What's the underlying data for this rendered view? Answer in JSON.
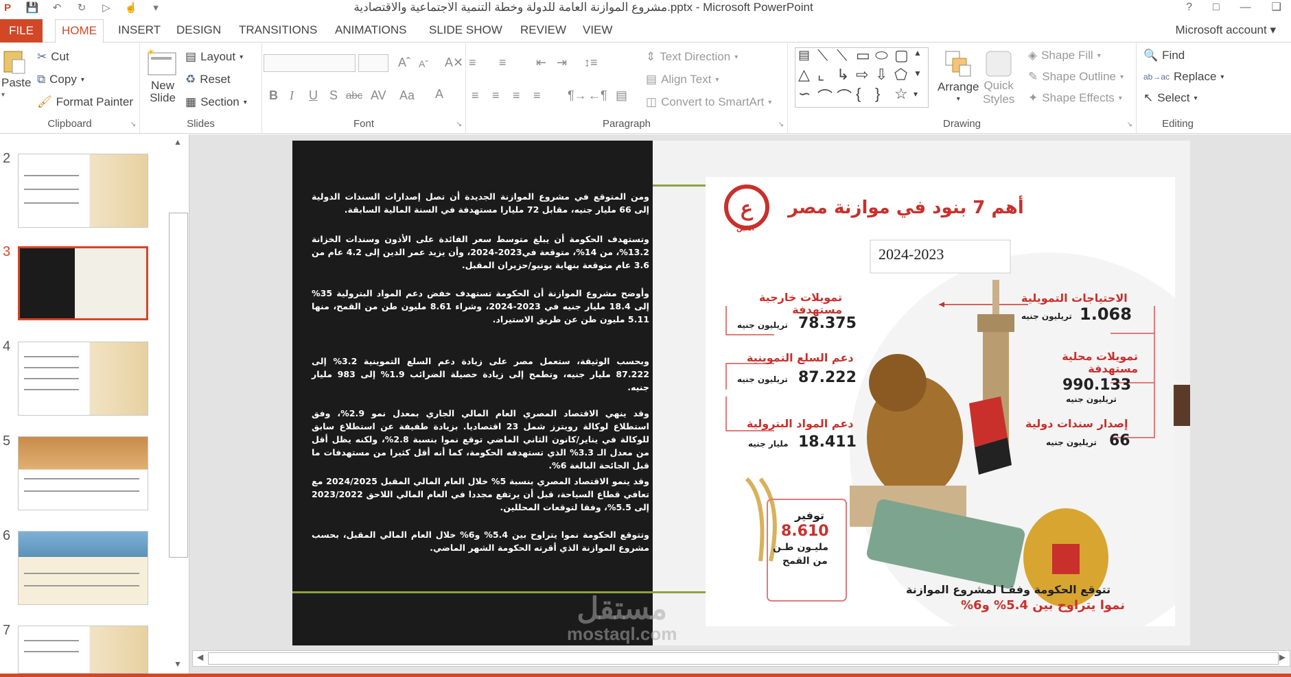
{
  "window": {
    "title": "مشروع الموازنة العامة للدولة وخطة التنمية الاجتماعية والاقتصادية.pptx - Microsoft PowerPoint",
    "help": "?",
    "account": "Microsoft account"
  },
  "tabs": [
    "FILE",
    "HOME",
    "INSERT",
    "DESIGN",
    "TRANSITIONS",
    "ANIMATIONS",
    "SLIDE SHOW",
    "REVIEW",
    "VIEW"
  ],
  "ribbon": {
    "clipboard": {
      "paste": "Paste",
      "cut": "Cut",
      "copy": "Copy",
      "format_painter": "Format Painter",
      "label": "Clipboard"
    },
    "slides": {
      "new_slide_1": "New",
      "new_slide_2": "Slide",
      "layout": "Layout",
      "reset": "Reset",
      "section": "Section",
      "label": "Slides"
    },
    "font": {
      "label": "Font"
    },
    "paragraph": {
      "text_direction": "Text Direction",
      "align_text": "Align Text",
      "convert_smartart": "Convert to SmartArt",
      "label": "Paragraph"
    },
    "drawing": {
      "arrange": "Arrange",
      "quick_styles_1": "Quick",
      "quick_styles_2": "Styles",
      "shape_fill": "Shape Fill",
      "shape_outline": "Shape Outline",
      "shape_effects": "Shape Effects",
      "label": "Drawing"
    },
    "editing": {
      "find": "Find",
      "replace": "Replace",
      "select": "Select",
      "label": "Editing"
    }
  },
  "thumbnails": [
    "2",
    "3",
    "4",
    "5",
    "6",
    "7"
  ],
  "slide": {
    "paragraphs": [
      "ومن المتوقع في مشروع الموازنة الجديدة أن تصل إصدارات السندات الدولية إلى 66 مليار جنيه، مقابل 72 مليارا مستهدفة في السنة المالية السابقة.",
      "وتستهدف الحكومة أن يبلغ متوسط سعر الفائدة على الأذون وسندات الخزانة 13.2%، من 14%، متوقعة في2023-2024، وأن يزيد عمر الدين إلى 4.2 عام من 3.6 عام متوقعة بنهاية يونيو/حزيران المقبل.",
      "وأوضح مشروع الموازنة أن الحكومة تستهدف خفض دعم المواد البترولية 35% إلى 18.4 مليار جنيه في 2023-2024، وشراء 8.61 مليون طن من القمح، منها 5.11 مليون طن عن طريق الاستيراد.",
      "وبحسب الوثيقة، ستعمل مصر على زيادة دعم السلع التموينية 3.2% إلى 87.222 مليار جنيه، وتطمح إلى زيادة حصيلة الضرائب 1.9% إلى 983 مليار جنيه.",
      "وقد ينهي الاقتصاد المصري العام المالي الجاري بمعدل نمو 2.9%، وفق استطلاع لوكالة رويترز شمل 23 اقتصاديا. بزيادة طفيفة عن استطلاع سابق للوكالة في يناير/كانون الثاني الماضي توقع نموا بنسبة 2.8%، ولكنه يظل أقل من معدل الـ 3.3% الذي تستهدفه الحكومة، كما أنه أقل كثيرا من مستهدفات ما قبل الجائحة البالغة 6%.",
      "وقد ينمو الاقتصاد المصري بنسبة 5% خلال العام المالي المقبل 2024/2025 مع تعافي قطاع السياحة، قبل أن يرتفع مجددا في العام المالي اللاحق 2023/2022 إلى 5.5%، وفقا لتوقعات المحللين.",
      "وتتوقع الحكومة نموا يتراوح بين 5.4% و6% خلال العام المالي المقبل، بحسب مشروع الموازنة الذي أقرته الحكومة الشهر الماضي."
    ],
    "infographic": {
      "logo_text": "العين",
      "title": "أهم 7 بنود في موازنة مصر",
      "year": "2024-2023",
      "items": [
        {
          "label": "الاحتياجات التمويلية",
          "value": "1.068",
          "unit": "تريليون جنيه"
        },
        {
          "label": "تمويلات خارجية مستهدفة",
          "value": "78.375",
          "unit": "تريليون جنيه"
        },
        {
          "label": "تمويلات محلية مستهدفة",
          "value": "990.133",
          "unit": "تريليون جنيه"
        },
        {
          "label": "دعم السلع التموينية",
          "value": "87.222",
          "unit": "تريليون جنيه"
        },
        {
          "label": "إصدار سندات دولية",
          "value": "66",
          "unit": "تريليون جنيه"
        },
        {
          "label": "دعم المواد البترولية",
          "value": "18.411",
          "unit": "مليار جنيه"
        }
      ],
      "wheat_label": "توفير",
      "wheat_value": "8.610",
      "wheat_unit_1": "مليـون طـن",
      "wheat_unit_2": "من القمح",
      "footer_1": "تتوقع الحكومة وفقـا لمشروع الموازنة",
      "footer_2": "نموا يتراوح بين 5.4% و6%"
    }
  },
  "watermark": {
    "main": "مستقل",
    "sub": "mostaql.com"
  }
}
